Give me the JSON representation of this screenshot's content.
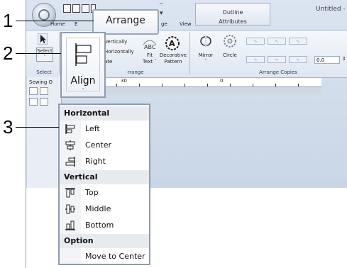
{
  "callouts": {
    "one": "1",
    "two": "2",
    "three": "3"
  },
  "window": {
    "title_partial": "Untitled -",
    "context_tab_top": "Outline",
    "context_tab_bottom": "Attributes",
    "tabs": {
      "home": "Home",
      "e": "E",
      "ge": "ge",
      "view": "View"
    }
  },
  "arrange_tab": {
    "label": "Arrange"
  },
  "ribbon": {
    "select_label": "Select",
    "select_group_label": "Select",
    "vertically": "Vertically",
    "horizontally": "Horizontally",
    "ate": "ate",
    "arrange_group_label": "rrange",
    "fit_text_line1": "Fit",
    "fit_text_line2": "Text ˇ",
    "decorative_line1": "Decorative",
    "decorative_line2": "Pattern",
    "mirror": "Mirror",
    "mirror_arrow": "ˇ",
    "circle": "Circle",
    "arrange_copies_label": "Arrange Copies",
    "copies_value": "0.0"
  },
  "side_panel": {
    "sewing_label": "Sewing O"
  },
  "ruler": {
    "n30": "30",
    "n0": "0"
  },
  "align_button": {
    "label": "Align",
    "arrow": "ˇ"
  },
  "menu": {
    "horizontal_header": "Horizontal",
    "left": "Left",
    "center": "Center",
    "right": "Right",
    "vertical_header": "Vertical",
    "top": "Top",
    "middle": "Middle",
    "bottom": "Bottom",
    "option_header": "Option",
    "move_to_center": "Move to Center"
  }
}
